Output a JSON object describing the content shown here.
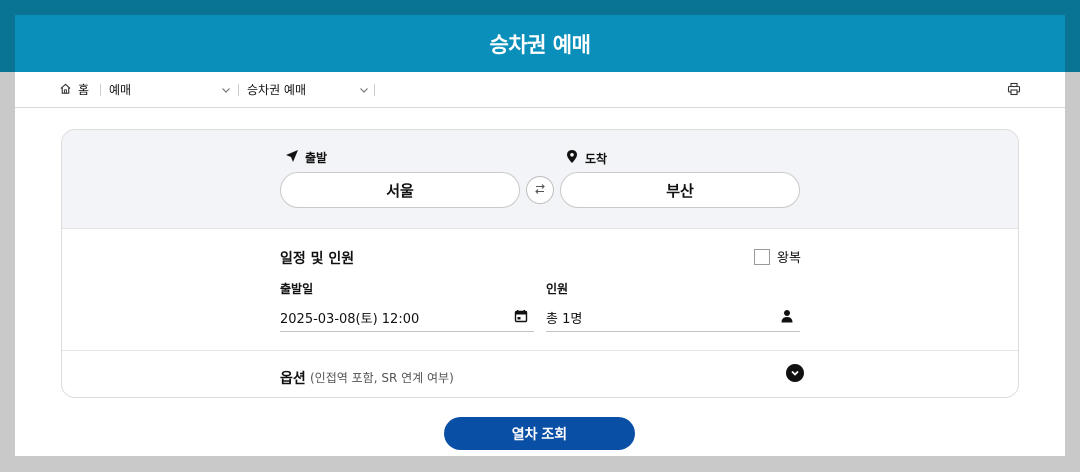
{
  "header": {
    "title": "승차권 예매"
  },
  "breadcrumb": {
    "home_label": "홈",
    "level1": "예매",
    "level2": "승차권 예매"
  },
  "route": {
    "departure_label": "출발",
    "departure_value": "서울",
    "arrival_label": "도착",
    "arrival_value": "부산"
  },
  "schedule": {
    "title": "일정 및 인원",
    "roundtrip_label": "왕복",
    "roundtrip_checked": false,
    "date_label": "출발일",
    "date_value": "2025-03-08(토) 12:00",
    "people_label": "인원",
    "people_value": "총 1명"
  },
  "options": {
    "title": "옵션",
    "subtitle": "(인접역 포함, SR 연계 여부)"
  },
  "search_button_label": "열차 조회",
  "colors": {
    "header_bg": "#0a8fba",
    "top_band": "#0a7494",
    "button_bg": "#0a4fa6"
  },
  "icons": {
    "home": "home-icon",
    "chevron": "chevron-down-icon",
    "print": "printer-icon",
    "departure": "navigation-arrow-icon",
    "arrival": "map-pin-icon",
    "swap": "swap-arrows-icon",
    "calendar": "calendar-icon",
    "person": "person-icon",
    "options_toggle": "chevron-circle-down-icon"
  }
}
